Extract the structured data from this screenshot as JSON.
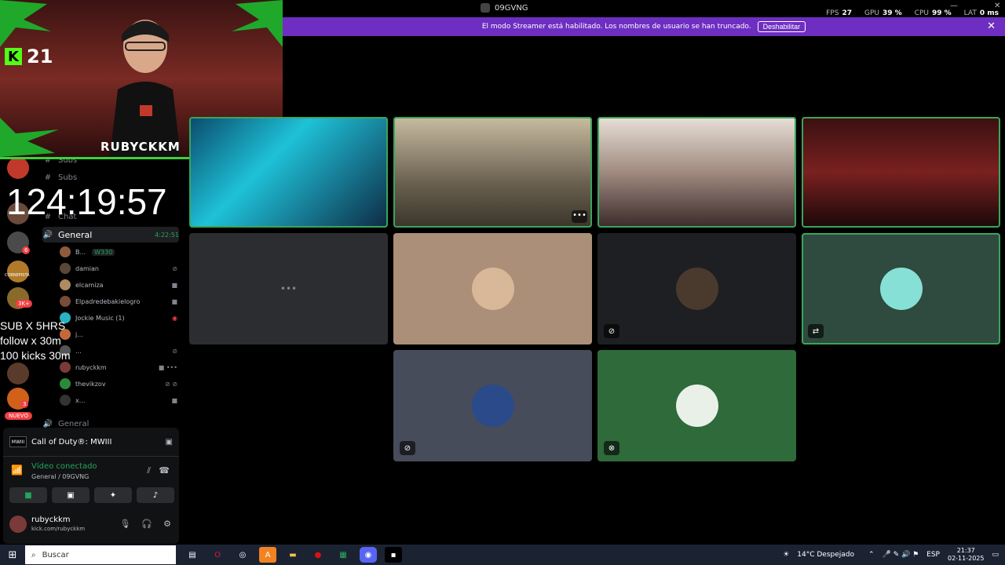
{
  "window": {
    "title": "09GVNG",
    "minimize": "—",
    "close": "✕"
  },
  "perf": {
    "fps_label": "FPS",
    "fps": "27",
    "gpu_label": "GPU",
    "gpu": "39 %",
    "cpu_label": "CPU",
    "cpu": "99 %",
    "lat_label": "LAT",
    "lat": "0 ms"
  },
  "banner": {
    "text": "El modo Streamer está habilitado. Los nombres de usuario se han truncado.",
    "button": "Deshabilitar",
    "close": "✕"
  },
  "overlay": {
    "kick_count": "21",
    "streamer_name": "RUBYCKKM",
    "timer": "124:19:57",
    "promo_lines": [
      "SUB X 5HRS",
      "follow x 30m",
      "100 kicks 30m"
    ]
  },
  "rail": {
    "badges": [
      "6",
      "3K+",
      "3"
    ],
    "server_label": "CORNEPISTA",
    "new_label": "NUEVO"
  },
  "channels": [
    {
      "name": "Subs",
      "icon": "#"
    },
    {
      "name": "Subs",
      "icon": "#"
    },
    {
      "name": "Chat",
      "icon": "#"
    }
  ],
  "voice_channel": {
    "name": "General",
    "time": "4:22:51"
  },
  "members": [
    {
      "name": "B...",
      "tag": "W330",
      "color": "#8e5a3c",
      "icon": ""
    },
    {
      "name": "damian",
      "color": "#5a4636",
      "icon": "mic-off"
    },
    {
      "name": "elcamiza",
      "color": "#b08a60",
      "icon": "video"
    },
    {
      "name": "Elpadredebakielogro",
      "color": "#7a4a3a",
      "icon": "video"
    },
    {
      "name": "Jockie Music (1)",
      "color": "#2ab1c4",
      "icon": "live"
    },
    {
      "name": "j...",
      "color": "#c06a3a",
      "icon": ""
    },
    {
      "name": "...",
      "color": "#555",
      "icon": "mic-off"
    },
    {
      "name": "rubyckkm",
      "color": "#7a3a3a",
      "icon": "video"
    },
    {
      "name": "thevikzov",
      "color": "#2a8a3a",
      "icon": "mic-off"
    },
    {
      "name": "x...",
      "color": "#333",
      "icon": "video"
    }
  ],
  "voice_channel_2": {
    "name": "General"
  },
  "panel": {
    "game": "Call of Duty®: MWIII",
    "game_logo": "MWIII",
    "status": "Vídeo conectado",
    "location": "General / 09GVNG",
    "user_name": "rubyckkm",
    "user_sub": "kick.com/rubyckkm"
  },
  "grid_tiles": [
    {
      "type": "video",
      "bg": "linear-gradient(135deg,#0a4a6a,#1ec2d8 40%,#0e2a44)",
      "speaking": true
    },
    {
      "type": "video",
      "bg": "linear-gradient(180deg,#c8bca0,#6a6050 60%,#3a342a)",
      "speaking": true,
      "more": "•••"
    },
    {
      "type": "video",
      "bg": "linear-gradient(180deg,#e8e0d8,#a08a80 50%,#3a2a2a)",
      "speaking": true
    },
    {
      "type": "video",
      "bg": "linear-gradient(180deg,#3a1010,#7a2020 50%,#1a0808)",
      "speaking": true
    },
    {
      "type": "loading",
      "bg": "#2b2d31",
      "more": "•••"
    },
    {
      "type": "avatar",
      "bg": "#ab8f78",
      "avatar": "#d9b89a"
    },
    {
      "type": "avatar",
      "bg": "#1e1f22",
      "avatar": "#4a3a2e",
      "icon": "mic-off"
    },
    {
      "type": "avatar",
      "bg": "#2f4a3e",
      "avatar": "#86e0d6",
      "icon": "share",
      "speaking": true
    },
    {
      "type": "avatar",
      "bg": "#474c5b",
      "avatar": "#2a4a8a",
      "icon": "mic-off"
    },
    {
      "type": "avatar",
      "bg": "#2f6a3a",
      "avatar": "#e8f0e8",
      "icon": "deafen"
    }
  ],
  "taskbar": {
    "search_placeholder": "Buscar",
    "weather": "14°C  Despejado",
    "lang": "ESP",
    "time": "21:37",
    "date": "02-11-2025"
  },
  "colors": {
    "accent": "#5865f2",
    "streamer_banner": "#6e2ec1",
    "online": "#23a55a",
    "kick_green": "#53fc18"
  }
}
